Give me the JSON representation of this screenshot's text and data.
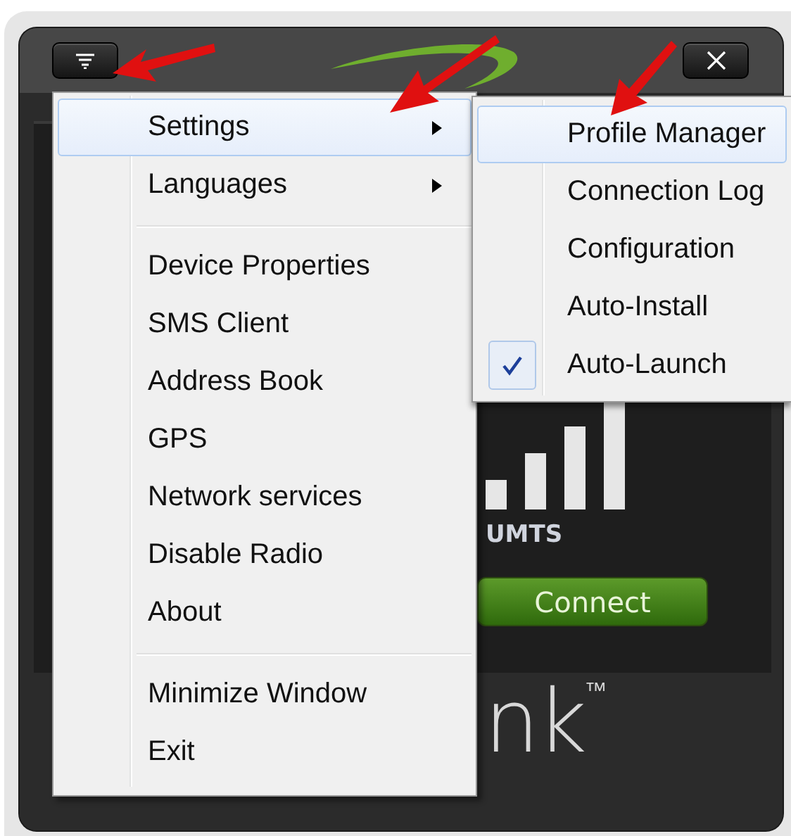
{
  "window": {
    "network": "UMTS",
    "connect_button": "Connect",
    "logo_text": "nk$^{™}$"
  },
  "menu": [
    {
      "kind": "item",
      "label": "Settings",
      "selected": true,
      "submenu": true
    },
    {
      "kind": "item",
      "label": "Languages",
      "selected": false,
      "submenu": true
    },
    {
      "kind": "separator"
    },
    {
      "kind": "item",
      "label": "Device Properties",
      "selected": false,
      "submenu": false
    },
    {
      "kind": "item",
      "label": "SMS Client",
      "selected": false,
      "submenu": false
    },
    {
      "kind": "item",
      "label": "Address Book",
      "selected": false,
      "submenu": false
    },
    {
      "kind": "item",
      "label": "GPS",
      "selected": false,
      "submenu": false
    },
    {
      "kind": "item",
      "label": "Network services",
      "selected": false,
      "submenu": false
    },
    {
      "kind": "item",
      "label": "Disable Radio",
      "selected": false,
      "submenu": false
    },
    {
      "kind": "item",
      "label": "About",
      "selected": false,
      "submenu": false
    },
    {
      "kind": "separator"
    },
    {
      "kind": "item",
      "label": "Minimize Window",
      "selected": false,
      "submenu": false
    },
    {
      "kind": "item",
      "label": "Exit",
      "selected": false,
      "submenu": false
    }
  ],
  "settings_submenu": [
    {
      "label": "Profile Manager",
      "selected": true,
      "checked": false
    },
    {
      "label": "Connection Log",
      "selected": false,
      "checked": false
    },
    {
      "label": "Configuration",
      "selected": false,
      "checked": false
    },
    {
      "label": "Auto-Install",
      "selected": false,
      "checked": false
    },
    {
      "label": "Auto-Launch",
      "selected": false,
      "checked": true
    }
  ]
}
